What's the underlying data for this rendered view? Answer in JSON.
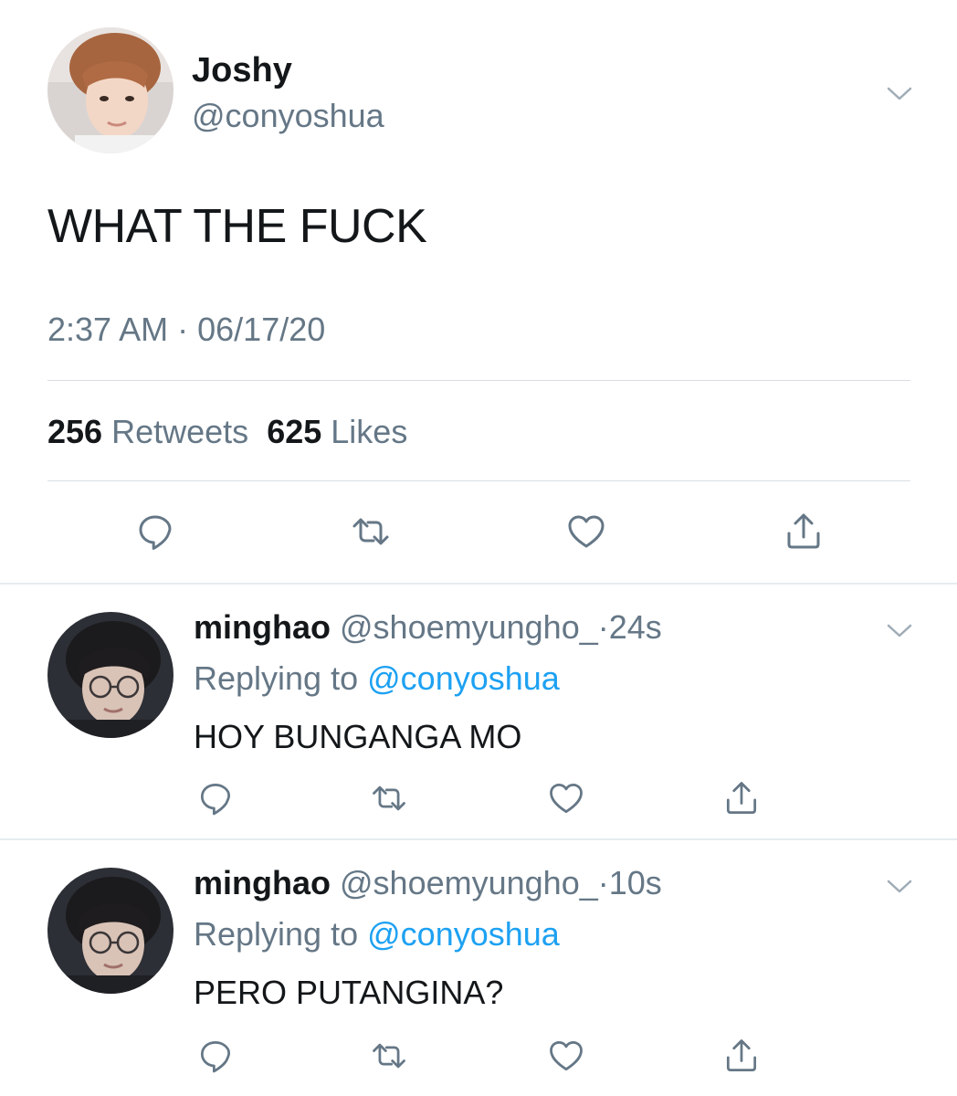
{
  "main_tweet": {
    "display_name": "Joshy",
    "handle": "@conyoshua",
    "text": "WHAT THE FUCK",
    "time": "2:37 AM",
    "separator": "·",
    "date": "06/17/20",
    "retweets_count": "256",
    "retweets_label": "Retweets",
    "likes_count": "625",
    "likes_label": "Likes"
  },
  "replies": [
    {
      "display_name": "minghao",
      "handle": "@shoemyungho_",
      "separator": "·",
      "time_ago": "24s",
      "replying_prefix": "Replying to",
      "replying_to": "@conyoshua",
      "text": "HOY BUNGANGA MO"
    },
    {
      "display_name": "minghao",
      "handle": "@shoemyungho_",
      "separator": "·",
      "time_ago": "10s",
      "replying_prefix": "Replying to",
      "replying_to": "@conyoshua",
      "text": "PERO PUTANGINA?"
    }
  ],
  "icons": {
    "reply": "reply-icon",
    "retweet": "retweet-icon",
    "like": "heart-icon",
    "share": "share-icon",
    "more": "chevron-down-icon"
  },
  "colors": {
    "primary_text": "#14171a",
    "secondary_text": "#657786",
    "link": "#1da1f2",
    "divider": "#e6ecf0"
  }
}
